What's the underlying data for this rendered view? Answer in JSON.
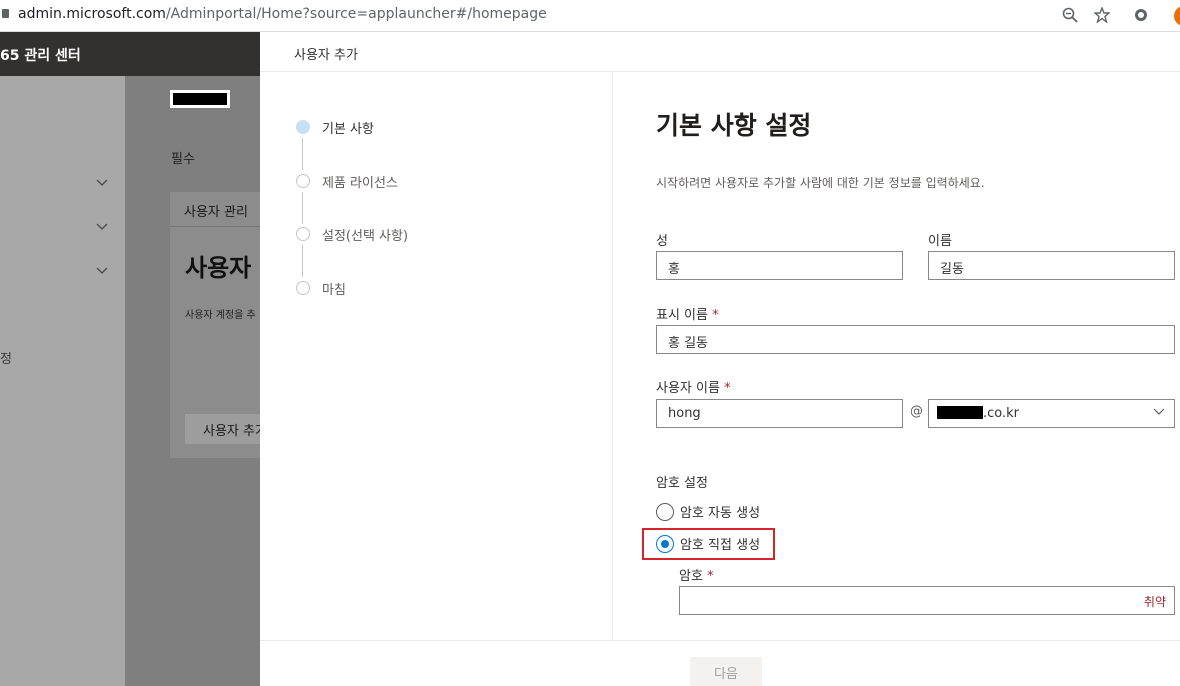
{
  "browser": {
    "url_host": "admin.microsoft.com",
    "url_rest": "/Adminportal/Home?source=applauncher#/homepage",
    "icons": [
      "lock-icon",
      "zoom-icon",
      "star-icon",
      "extension-icon",
      "profile-avatar"
    ]
  },
  "portal": {
    "title": "65 관리 센터",
    "nav_fragment": "정",
    "required_label": "필수",
    "card": {
      "header": "사용자 관리",
      "title": "사용자",
      "description": "사용자 계정을 추",
      "button": "사용자 추가"
    }
  },
  "panel": {
    "title": "사용자 추가",
    "steps": [
      {
        "label": "기본 사항",
        "active": true
      },
      {
        "label": "제품 라이선스",
        "active": false
      },
      {
        "label": "설정(선택 사항)",
        "active": false
      },
      {
        "label": "마침",
        "active": false
      }
    ],
    "form": {
      "title": "기본 사항 설정",
      "description": "시작하려면 사용자로 추가할 사람에 대한 기본 정보를 입력하세요.",
      "last_name": {
        "label": "성",
        "value": "홍"
      },
      "first_name": {
        "label": "이름",
        "value": "길동"
      },
      "display_name": {
        "label": "표시 이름",
        "required_mark": "*",
        "value": "홍 길동"
      },
      "username": {
        "label": "사용자 이름",
        "required_mark": "*",
        "value": "hong",
        "at": "@",
        "domain_suffix": ".co.kr"
      },
      "password_settings": {
        "label": "암호 설정",
        "options": [
          {
            "label": "암호 자동 생성",
            "checked": false
          },
          {
            "label": "암호 직접 생성",
            "checked": true
          }
        ]
      },
      "password": {
        "label": "암호",
        "required_mark": "*",
        "value": "",
        "strength": "취약"
      }
    },
    "next_button": "다음"
  },
  "colors": {
    "accent": "#0078d4",
    "highlight_box": "#d6242b",
    "required": "#a4262c",
    "topbar": "#323130"
  }
}
